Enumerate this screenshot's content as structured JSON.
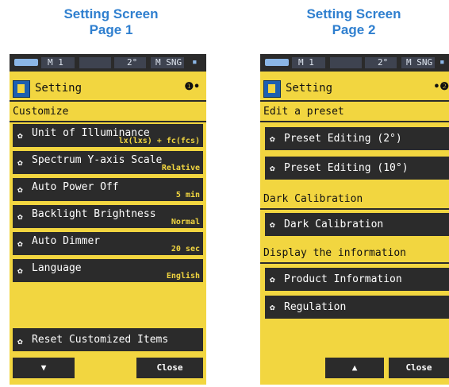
{
  "page1": {
    "caption_line1": "Setting Screen",
    "caption_line2": "Page 1",
    "status": {
      "mode": "M 1",
      "angle": "2°",
      "measure": "M SNG"
    },
    "title": "Setting",
    "page_indicator": "❶•",
    "section": "Customize",
    "items": [
      {
        "label": "Unit of Illuminance",
        "value": "lx(lxs) + fc(fcs)"
      },
      {
        "label": "Spectrum Y-axis Scale",
        "value": "Relative"
      },
      {
        "label": "Auto Power Off",
        "value": "5 min"
      },
      {
        "label": "Backlight Brightness",
        "value": "Normal"
      },
      {
        "label": "Auto Dimmer",
        "value": "20 sec"
      },
      {
        "label": "Language",
        "value": "English"
      }
    ],
    "reset_label": "Reset Customized Items",
    "down_arrow": "▼",
    "close_label": "Close"
  },
  "page2": {
    "caption_line1": "Setting Screen",
    "caption_line2": "Page 2",
    "status": {
      "mode": "M 1",
      "angle": "2°",
      "measure": "M SNG"
    },
    "title": "Setting",
    "page_indicator": "•❷",
    "section_preset": "Edit a preset",
    "preset_2": "Preset Editing (2°)",
    "preset_10": "Preset Editing (10°)",
    "section_dark": "Dark Calibration",
    "dark_cal": "Dark Calibration",
    "section_info": "Display the information",
    "product_info": "Product Information",
    "regulation": "Regulation",
    "up_arrow": "▲",
    "close_label": "Close"
  },
  "colors": {
    "screen_bg": "#f2d640",
    "bar": "#2b2b2b",
    "caption": "#2f7fcf",
    "value_text": "#f2d640"
  },
  "icons": {
    "gear": "gear-icon",
    "setting": "setting-icon",
    "battery": "battery-icon"
  }
}
